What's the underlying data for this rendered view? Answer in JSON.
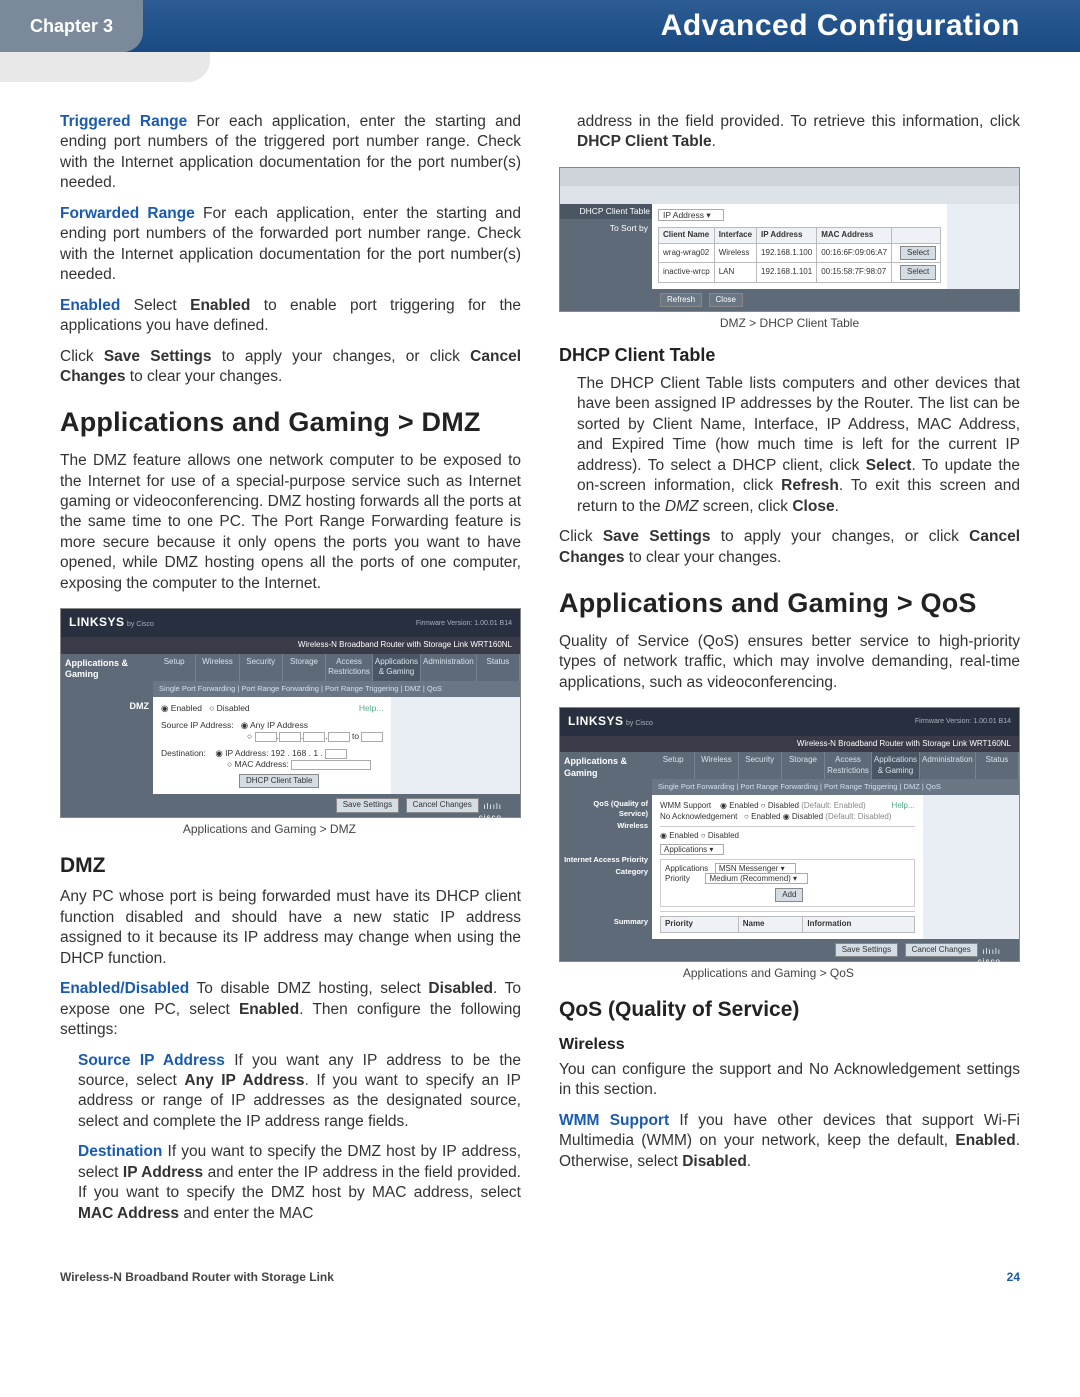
{
  "header": {
    "chapter": "Chapter 3",
    "title": "Advanced Configuration"
  },
  "left": {
    "p1_label": "Triggered Range",
    "p1_text": "  For each application, enter the starting and ending port numbers of the triggered port number range. Check with the Internet application documentation for the port number(s) needed.",
    "p2_label": "Forwarded Range",
    "p2_text": "  For each application, enter the starting and ending port numbers of the forwarded port number range. Check with the Internet application documentation for the port number(s) needed.",
    "p3_label": "Enabled",
    "p3_text_a": "  Select ",
    "p3_bold": "Enabled",
    "p3_text_b": " to enable port triggering for the applications you have defined.",
    "p4_a": "Click ",
    "p4_b1": "Save Settings",
    "p4_b": " to apply your changes, or click ",
    "p4_b2": "Cancel Changes",
    "p4_c": " to clear your changes.",
    "h1_dmz": "Applications and Gaming > DMZ",
    "p5": "The DMZ feature allows one network computer to be exposed to the Internet for use of a special-purpose service such as Internet gaming or videoconferencing. DMZ hosting forwards all the ports at the same time to one PC. The Port Range Forwarding feature is more secure because it only opens the ports you want to have opened, while DMZ hosting opens all the ports of one computer, exposing the computer to the Internet.",
    "fig1_caption": "Applications and Gaming > DMZ",
    "h2_dmz": "DMZ",
    "p6": "Any PC whose port is being forwarded must have its DHCP client function disabled and should have a new static IP address assigned to it because its IP address may change when using the DHCP function.",
    "p7_label": "Enabled/Disabled",
    "p7_a": " To disable DMZ hosting, select ",
    "p7_b1": "Disabled",
    "p7_b": ". To expose one PC, select ",
    "p7_b2": "Enabled",
    "p7_c": ". Then configure the following settings:",
    "p8_label": "Source IP Address",
    "p8_a": "  If you want any IP address to be the source, select ",
    "p8_b1": "Any IP Address",
    "p8_b": ". If you want to specify an IP address or range of IP addresses as the designated source, select and complete the IP address range fields.",
    "p9_label": "Destination",
    "p9_a": "  If you want to specify the DMZ host by IP address, select ",
    "p9_b1": "IP Address",
    "p9_b": " and enter the IP address in the field provided. If you want to specify the DMZ host by MAC address, select ",
    "p9_b2": "MAC Address",
    "p9_c": " and enter the MAC"
  },
  "right": {
    "p1_a": "address in the field provided. To retrieve this information, click ",
    "p1_b": "DHCP Client Table",
    "p1_c": ".",
    "fig2_caption": "DMZ > DHCP Client Table",
    "h3_dhcp": "DHCP Client Table",
    "p2_a": "The DHCP Client Table lists computers and other devices that have been assigned IP addresses by the Router. The list can be sorted by Client Name, Interface, IP Address, MAC Address, and Expired Time (how much time is left for the current IP address). To select a DHCP client, click ",
    "p2_b1": "Select",
    "p2_b": ". To update the on-screen information, click ",
    "p2_b2": "Refresh",
    "p2_c": ". To exit this screen and return to the ",
    "p2_i": "DMZ",
    "p2_d": " screen, click ",
    "p2_b3": "Close",
    "p2_e": ".",
    "p3_a": "Click ",
    "p3_b1": "Save Settings",
    "p3_b": " to apply your changes, or click ",
    "p3_b2": "Cancel Changes",
    "p3_c": " to clear your changes.",
    "h1_qos": "Applications and Gaming > QoS",
    "p4": "Quality of Service (QoS) ensures better service to high-priority types of network traffic, which may involve demanding, real-time applications, such as videoconferencing.",
    "fig3_caption": "Applications and Gaming > QoS",
    "h2_qos": "QoS (Quality of Service)",
    "h4_wireless": "Wireless",
    "p5": "You can configure the support and No Acknowledgement settings in this section.",
    "p6_label": "WMM Support",
    "p6_a": "  If you have other devices that support Wi-Fi Multimedia (WMM) on your network, keep the default, ",
    "p6_b1": "Enabled",
    "p6_b": ". Otherwise, select ",
    "p6_b2": "Disabled",
    "p6_c": "."
  },
  "ui_common": {
    "brand": "LINKSYS",
    "brand_sub": "by Cisco",
    "fw": "Firmware Version: 1.00.01 B14",
    "router_title": "Wireless-N Broadband Router with Storage Link    WRT160NL",
    "side_label": "Applications & Gaming",
    "tabs": [
      "Setup",
      "Wireless",
      "Security",
      "Storage",
      "Access Restrictions",
      "Applications & Gaming",
      "Administration",
      "Status"
    ],
    "subtabs_dmz": "Single Port Forwarding   |   Port Range Forwarding   |   Port Range Triggering   |   DMZ   |   QoS",
    "btn_save": "Save Settings",
    "btn_cancel": "Cancel Changes",
    "cisco": "cisco",
    "help": "Help..."
  },
  "ui_dmz": {
    "section": "DMZ",
    "enabled": "Enabled",
    "disabled": "Disabled",
    "src_label": "Source IP Address:",
    "any_ip": "Any IP Address",
    "dest_label": "Destination:",
    "ip_addr": "IP Address: 192 . 168 . 1 .",
    "mac_addr": "MAC Address:",
    "dhcp_btn": "DHCP Client Table"
  },
  "ui_dhcp": {
    "side_title": "DHCP Client Table",
    "sort": "To Sort by",
    "sort_val": "IP Address",
    "cols": [
      "Client Name",
      "Interface",
      "IP Address",
      "MAC Address",
      ""
    ],
    "rows": [
      [
        "wrag-wrag02",
        "Wireless",
        "192.168.1.100",
        "00:16:6F:09:06:A7",
        "Select"
      ],
      [
        "inactive-wrcp",
        "LAN",
        "192.168.1.101",
        "00:15:58:7F:98:07",
        "Select"
      ]
    ],
    "refresh": "Refresh",
    "close": "Close"
  },
  "ui_qos": {
    "section1": "QoS (Quality of Service)",
    "wireless": "Wireless",
    "wmm": "WMM Support",
    "noack": "No Acknowledgement",
    "en": "Enabled",
    "dis": "Disabled",
    "def_en": "(Default: Enabled)",
    "def_dis": "(Default: Disabled)",
    "iap": "Internet Access Priority",
    "cat": "Category",
    "cat_val": "Applications",
    "apps": "Applications",
    "apps_val": "MSN Messenger",
    "prio": "Priority",
    "prio_val": "Medium (Recommend)",
    "add": "Add",
    "summary": "Summary",
    "sum_cols": [
      "Priority",
      "Name",
      "Information"
    ]
  },
  "footer": {
    "left": "Wireless-N Broadband Router with Storage Link",
    "right": "24"
  }
}
